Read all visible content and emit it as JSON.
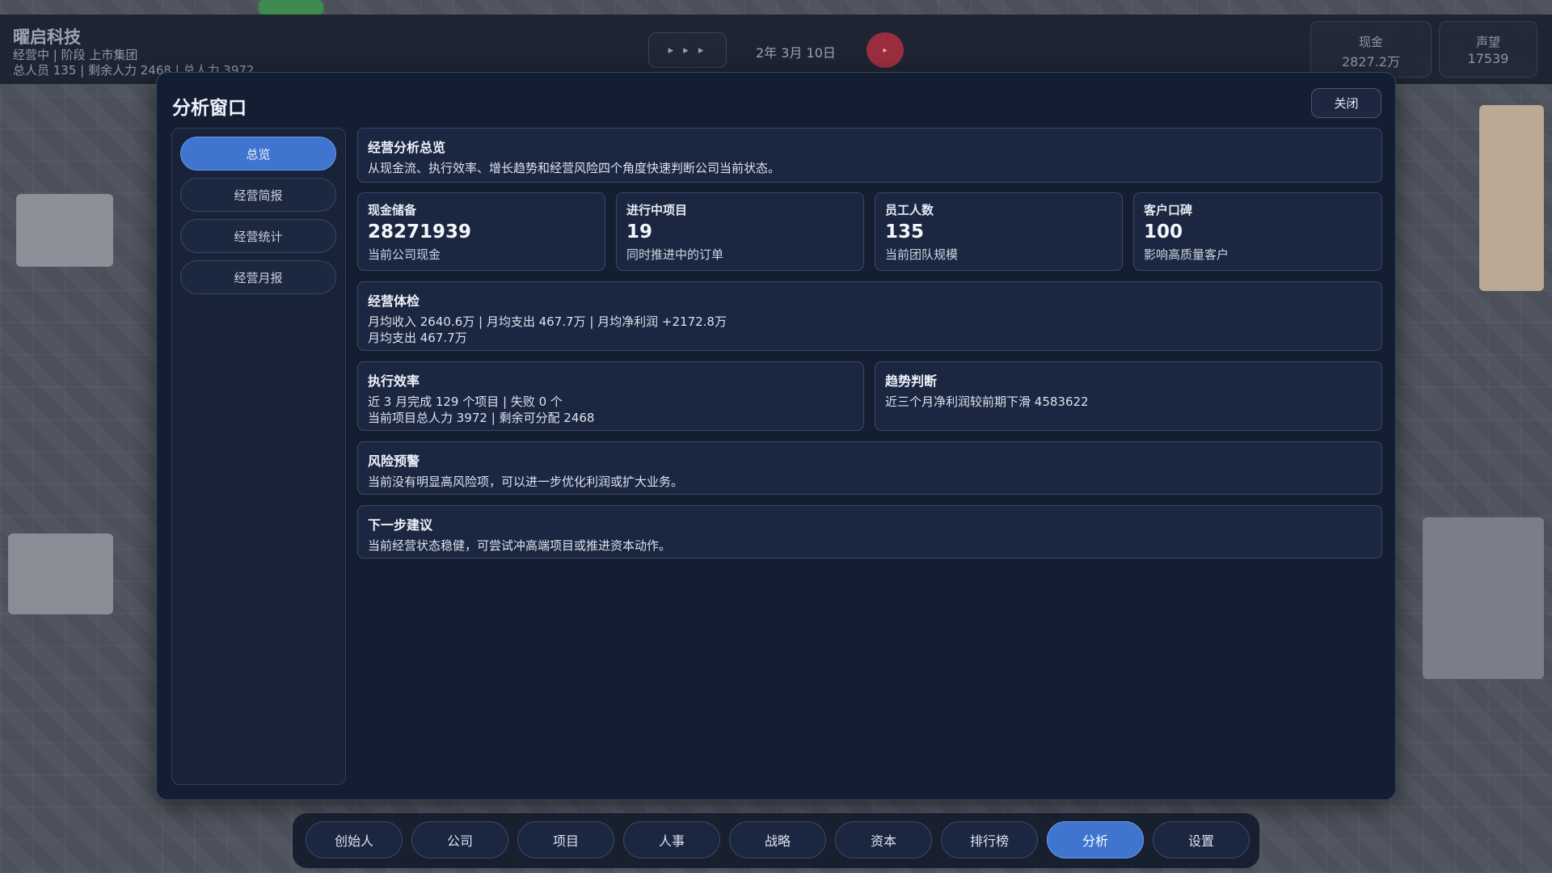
{
  "hud": {
    "company_name": "曜启科技",
    "company_status": "经营中 | 阶段 上市集团",
    "company_staff": "总人员 135 | 剩余人力 2468 | 总人力 3972",
    "speed_label": "▸ ▸ ▸",
    "date": "2年 3月 10日",
    "pause_icon_glyph": "▸",
    "cash_label": "现金",
    "cash_value": "2827.2万",
    "fame_label": "声望",
    "fame_value": "17539"
  },
  "window": {
    "title": "分析窗口",
    "close_label": "关闭"
  },
  "side_nav": {
    "items": [
      {
        "label": "总览",
        "active": true
      },
      {
        "label": "经营简报",
        "active": false
      },
      {
        "label": "经营统计",
        "active": false
      },
      {
        "label": "经营月报",
        "active": false
      }
    ]
  },
  "overview": {
    "title": "经营分析总览",
    "desc": "从现金流、执行效率、增长趋势和经营风险四个角度快速判断公司当前状态。"
  },
  "stats": [
    {
      "label": "现金储备",
      "value": "28271939",
      "note": "当前公司现金"
    },
    {
      "label": "进行中项目",
      "value": "19",
      "note": "同时推进中的订单"
    },
    {
      "label": "员工人数",
      "value": "135",
      "note": "当前团队规模"
    },
    {
      "label": "客户口碑",
      "value": "100",
      "note": "影响高质量客户"
    }
  ],
  "health": {
    "title": "经营体检",
    "line1": "月均收入 2640.6万 | 月均支出 467.7万 | 月均净利润 +2172.8万",
    "line2": "月均支出 467.7万"
  },
  "efficiency": {
    "title": "执行效率",
    "line1": "近 3 月完成 129 个项目 | 失败 0 个",
    "line2": "当前项目总人力 3972 | 剩余可分配 2468"
  },
  "trend": {
    "title": "趋势判断",
    "line1": "近三个月净利润较前期下滑 4583622"
  },
  "risk": {
    "title": "风险预警",
    "line1": "当前没有明显高风险项，可以进一步优化利润或扩大业务。"
  },
  "advice": {
    "title": "下一步建议",
    "line1": "当前经营状态稳健，可尝试冲高端项目或推进资本动作。"
  },
  "bottom_nav": {
    "tabs": [
      {
        "label": "创始人",
        "active": false
      },
      {
        "label": "公司",
        "active": false
      },
      {
        "label": "项目",
        "active": false
      },
      {
        "label": "人事",
        "active": false
      },
      {
        "label": "战略",
        "active": false
      },
      {
        "label": "资本",
        "active": false
      },
      {
        "label": "排行榜",
        "active": false
      },
      {
        "label": "分析",
        "active": true
      },
      {
        "label": "设置",
        "active": false
      }
    ]
  },
  "colors": {
    "accent": "#3f74cf",
    "panel": "#141e33",
    "card": "#1b2740",
    "pause": "#9a2e3e"
  }
}
